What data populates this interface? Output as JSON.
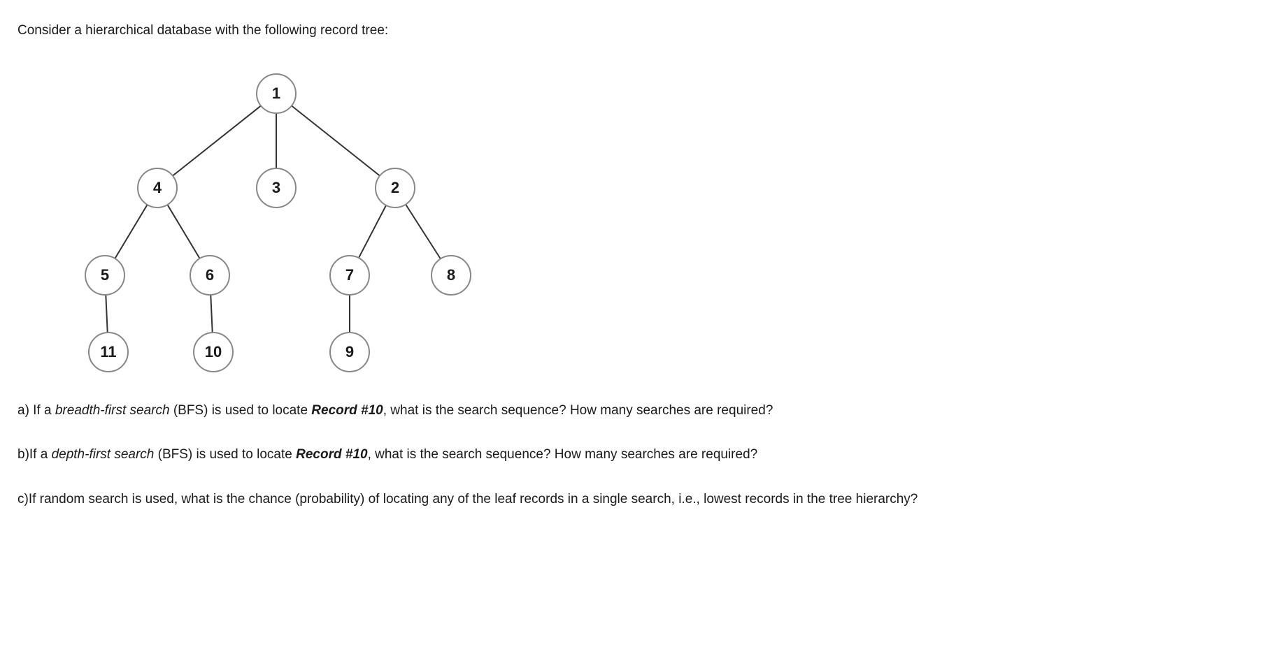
{
  "intro": "Consider a hierarchical database with the following record tree:",
  "tree": {
    "nodes": {
      "n1": "1",
      "n2": "2",
      "n3": "3",
      "n4": "4",
      "n5": "5",
      "n6": "6",
      "n7": "7",
      "n8": "8",
      "n9": "9",
      "n10": "10",
      "n11": "11"
    },
    "edges": [
      [
        "1",
        "4"
      ],
      [
        "1",
        "3"
      ],
      [
        "1",
        "2"
      ],
      [
        "4",
        "5"
      ],
      [
        "4",
        "6"
      ],
      [
        "2",
        "7"
      ],
      [
        "2",
        "8"
      ],
      [
        "5",
        "11"
      ],
      [
        "6",
        "10"
      ],
      [
        "7",
        "9"
      ]
    ]
  },
  "questions": {
    "a": {
      "prefix": "a) If a ",
      "term": "breadth-first search",
      "mid1": " (BFS) is used to locate ",
      "target": "Record #10",
      "suffix": ", what is the search sequence? How many searches are required?"
    },
    "b": {
      "prefix": "b)If a ",
      "term": "depth-first search",
      "mid1": " (BFS) is used to locate ",
      "target": "Record #10",
      "suffix": ", what is the search sequence? How many searches are required?"
    },
    "c": {
      "text": "c)If random search is used, what is the chance (probability) of locating any of the leaf records in a single search, i.e., lowest records in the tree hierarchy?"
    }
  }
}
